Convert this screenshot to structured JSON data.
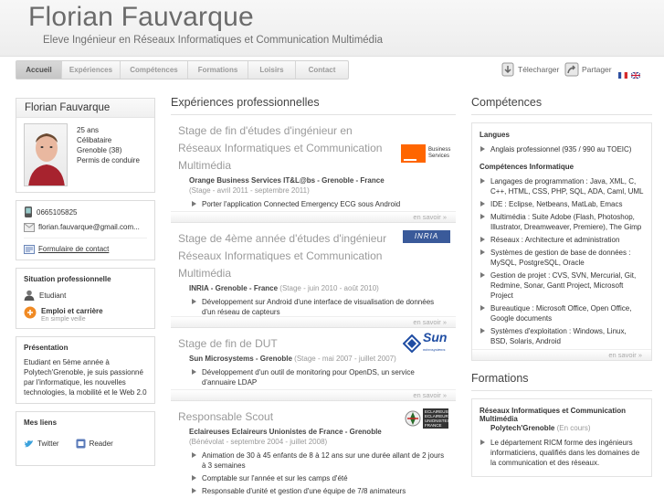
{
  "header": {
    "title": "Florian Fauvarque",
    "subtitle": "Eleve Ingénieur en Réseaux Informatiques et Communication Multimédia"
  },
  "nav": {
    "items": [
      {
        "label": "Accueil",
        "active": true
      },
      {
        "label": "Expériences",
        "active": false
      },
      {
        "label": "Compétences",
        "active": false
      },
      {
        "label": "Formations",
        "active": false
      },
      {
        "label": "Loisirs",
        "active": false
      },
      {
        "label": "Contact",
        "active": false
      }
    ]
  },
  "tools": {
    "download_label": "Télecharger",
    "share_label": "Partager"
  },
  "profile": {
    "name": "Florian Fauvarque",
    "age": "25 ans",
    "status": "Célibataire",
    "city": "Grenoble (38)",
    "license": "Permis de conduire",
    "phone": "0665105825",
    "email": "florian.fauvarque@gmail.com...",
    "contact_form": "Formulaire de contact"
  },
  "situation": {
    "title": "Situation professionnelle",
    "status": "Etudiant",
    "job_title": "Emploi et carrière",
    "job_sub": "En simple veille"
  },
  "presentation": {
    "title": "Présentation",
    "text": "Etudiant en 5ème année à Polytech'Grenoble, je suis passionné par l'informatique, les nouvelles technologies, la mobilité et le Web 2.0"
  },
  "links": {
    "title": "Mes liens",
    "twitter": "Twitter",
    "reader": "Reader"
  },
  "experiences": {
    "title": "Expériences professionnelles",
    "more_label": "en savoir »",
    "items": [
      {
        "title": "Stage de fin d'études d'ingénieur en Réseaux Informatiques et Communication Multimédia",
        "company": "Orange Business Services IT&L@bs - Grenoble - France",
        "dates": "(Stage - avril 2011 - septembre 2011)",
        "bullets": [
          "Porter l'application Connected Emergency ECG sous Android"
        ],
        "logo": {
          "brand": "orange",
          "text": "Business Services"
        }
      },
      {
        "title": "Stage de 4ème année d'études d'ingénieur Réseaux Informatiques et Communication Multimédia",
        "company": "INRIA - Grenoble - France",
        "dates": "(Stage - juin 2010 - août 2010)",
        "bullets": [
          "Développement sur Android d'une interface de visualisation de données d'un réseau de capteurs"
        ],
        "logo": {
          "text": "INRIA"
        }
      },
      {
        "title": "Stage de fin de DUT",
        "company": "Sun Microsystems - Grenoble",
        "dates": "(Stage - mai 2007 - juillet 2007)",
        "bullets": [
          "Développement d'un outil de monitoring pour OpenDS, un service d'annuaire LDAP"
        ],
        "logo": {
          "text": "Sun",
          "sub": "microsystems"
        }
      },
      {
        "title": "Responsable Scout",
        "company": "Eclaireuses Eclaireurs Unionistes de France - Grenoble",
        "dates": "(Bénévolat - septembre 2004 - juillet 2008)",
        "bullets": [
          "Animation de 30 à 45 enfants de 8 à 12 ans sur une durée allant de 2 jours à 3 semaines",
          "Comptable sur l'année et sur les camps d'été",
          "Responsable d'unité et gestion d'une équipe de 7/8 animateurs"
        ],
        "logo": {
          "text": "ECLAIREUSES ECLAIREURS UNIONISTES FRANCE"
        }
      }
    ]
  },
  "competences": {
    "title": "Compétences",
    "langues_title": "Langues",
    "langues": [
      "Anglais professionnel (935 / 990 au TOEIC)"
    ],
    "info_title": "Compétences Informatique",
    "info": [
      "Langages de programmation : Java, XML, C, C++, HTML, CSS, PHP, SQL, ADA, Caml, UML",
      "IDE : Eclipse, Netbeans, MatLab, Emacs",
      "Multimédia : Suite Adobe (Flash, Photoshop, Illustrator, Dreamweaver, Premiere), The Gimp",
      "Réseaux : Architecture et administration",
      "Systèmes de gestion de base de données : MySQL, PostgreSQL, Oracle",
      "Gestion de projet : CVS, SVN, Mercurial, Git, Redmine, Sonar, Gantt Project, Microsoft Project",
      "Bureautique : Microsoft Office, Open Office, Google documents",
      "Systèmes d'exploitation : Windows, Linux, BSD, Solaris, Android"
    ],
    "more_label": "en savoir »"
  },
  "formations": {
    "title": "Formations",
    "degree": "Réseaux Informatiques et Communication Multimédia",
    "school": "Polytech'Grenoble",
    "school_status": "(En cours)",
    "bullets": [
      "Le département RICM forme des ingénieurs informaticiens, qualifiés dans les domaines de la communication et des réseaux."
    ]
  },
  "colors": {
    "orange": "#ff6600",
    "sun_blue": "#1f4da3",
    "inria_blue": "#3a5a9a"
  }
}
